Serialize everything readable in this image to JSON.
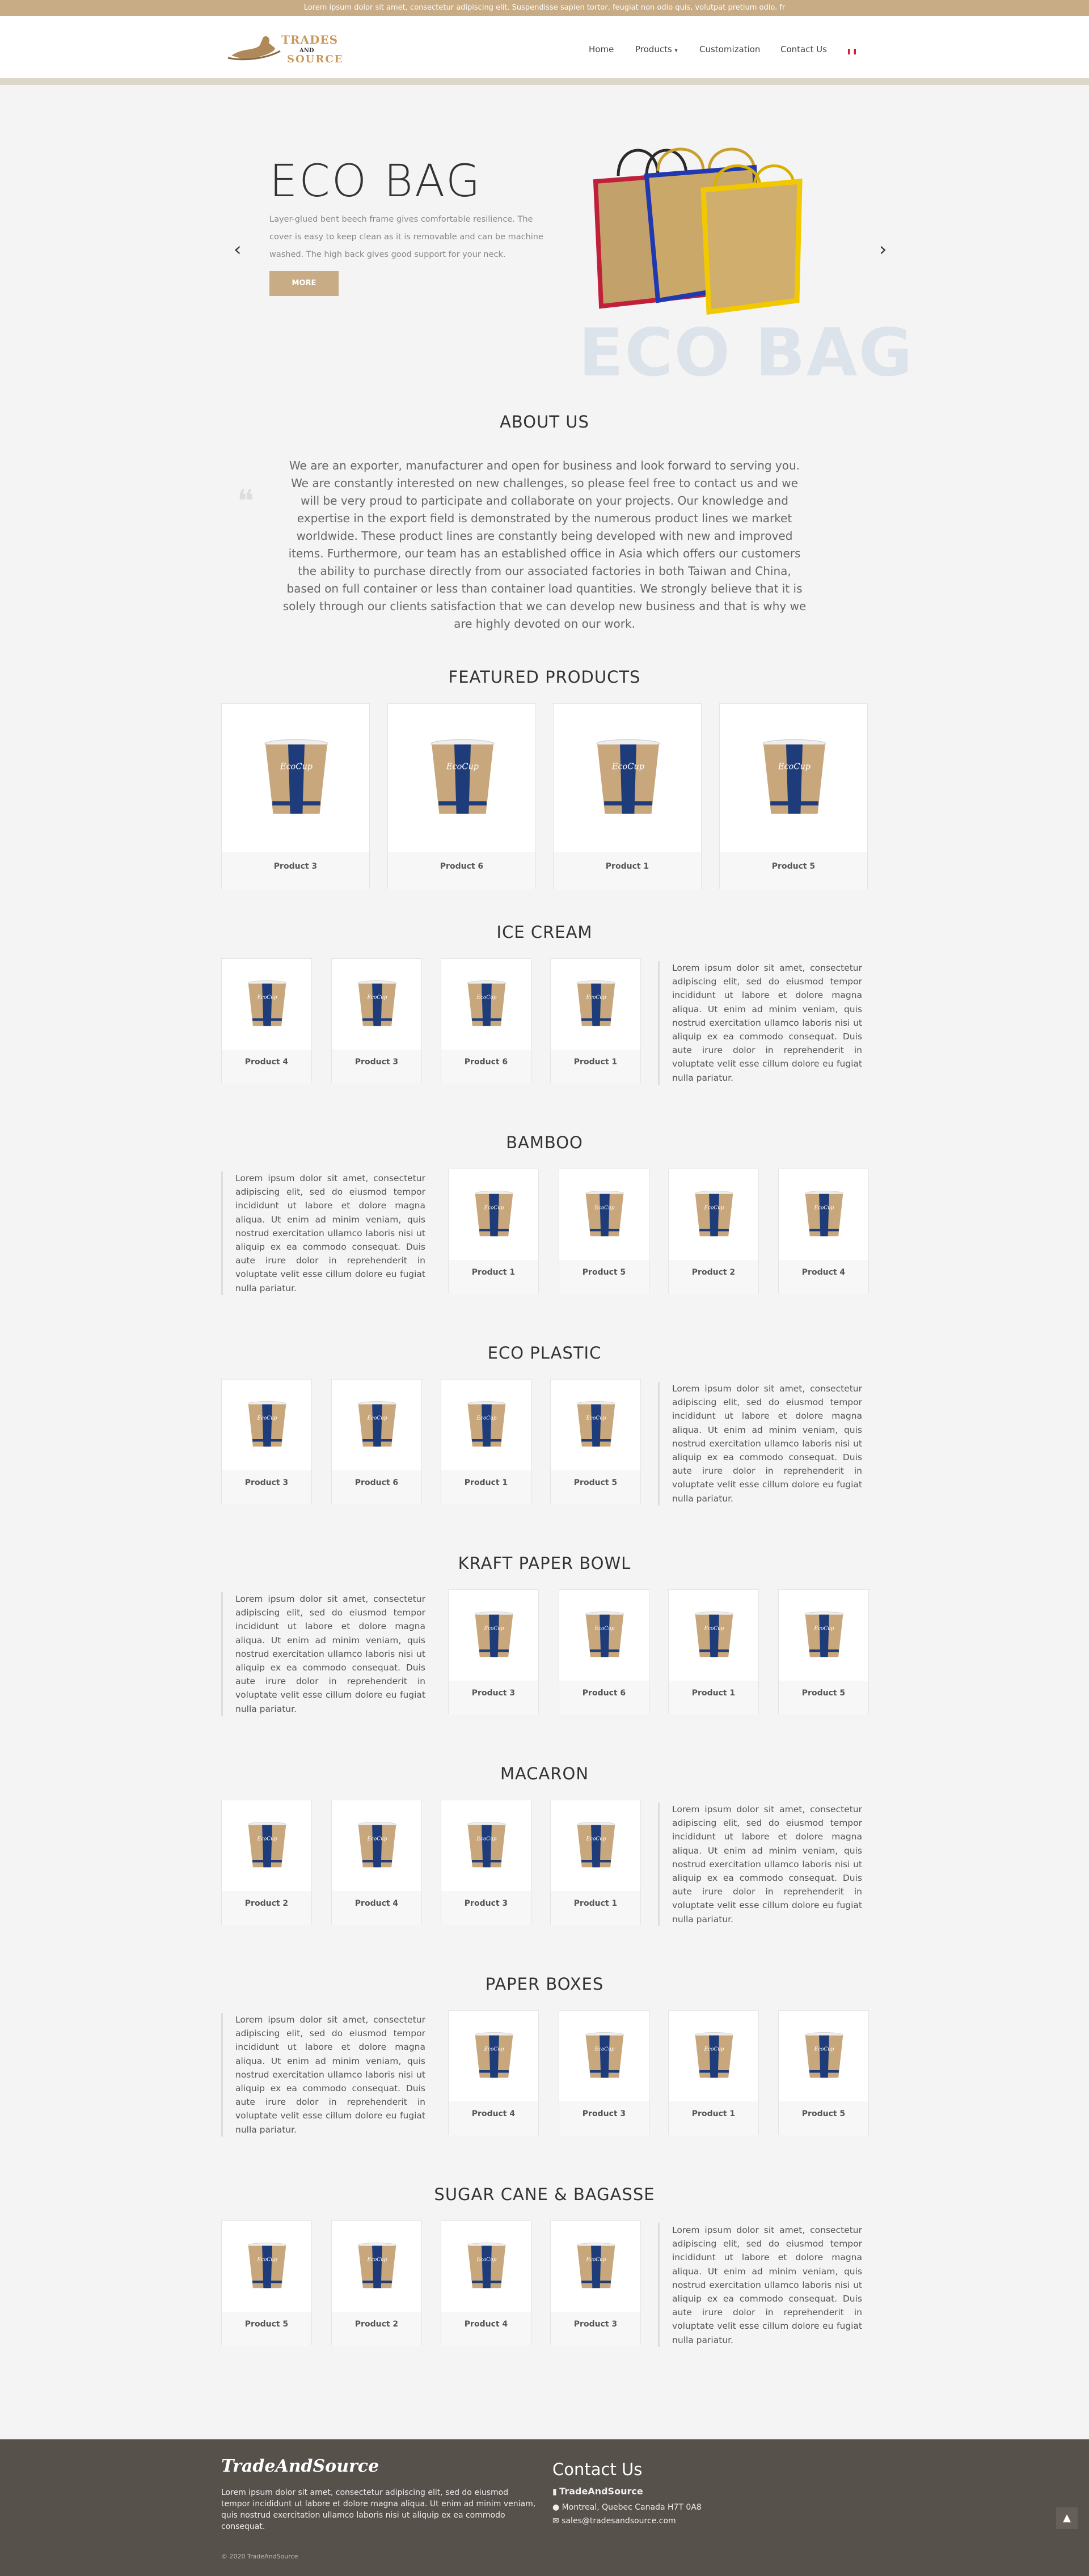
{
  "topbar": {
    "text": "Lorem ipsum dolor sit amet, consectetur adipiscing elit. Suspendisse sapien tortor, feugiat non odio quis, volutpat pretium odio. fr"
  },
  "logo": {
    "line1": "TRADES",
    "line2": "AND",
    "line3": "SOURCE"
  },
  "nav": {
    "home": "Home",
    "products": "Products",
    "customization": "Customization",
    "contact": "Contact Us"
  },
  "hero": {
    "title": "ECO BAG",
    "description": "Layer-glued bent beech frame gives comfortable resilience. The cover is easy to keep clean as it is removable and can be machine washed. The high back gives good support for your neck.",
    "button": "MORE",
    "watermark": "ECO BAG",
    "prev": "‹",
    "next": "›"
  },
  "about": {
    "title": "ABOUT US",
    "text": "We are an exporter, manufacturer and open for business and look forward to serving you. We are constantly interested on new challenges, so please feel free to contact us and we will be very proud to participate and collaborate on your projects. Our knowledge and expertise in the export field is demonstrated by the numerous product lines we market worldwide. These product lines are constantly being developed with new and improved items. Furthermore, our team has an established office in Asia which offers our customers the ability to purchase directly from our associated factories in both Taiwan and China, based on full container or less than container load quantities. We strongly believe that it is solely through our clients satisfaction that we can develop new business and that is why we are highly devoted on our work."
  },
  "featured": {
    "title": "FEATURED PRODUCTS",
    "products": [
      "Product 3",
      "Product 6",
      "Product 1",
      "Product 5"
    ]
  },
  "lorem": "Lorem ipsum dolor sit amet, consectetur adipiscing elit, sed do eiusmod tempor incididunt ut labore et dolore magna aliqua. Ut enim ad minim veniam, quis nostrud exercitation ullamco laboris nisi ut aliquip ex ea commodo consequat. Duis aute irure dolor in reprehenderit in voluptate velit esse cillum dolore eu fugiat nulla pariatur.",
  "categories": [
    {
      "title": "ICE CREAM",
      "products": [
        "Product 4",
        "Product 3",
        "Product 6",
        "Product 1"
      ]
    },
    {
      "title": "BAMBOO",
      "products": [
        "Product 1",
        "Product 5",
        "Product 2",
        "Product 4"
      ]
    },
    {
      "title": "ECO PLASTIC",
      "products": [
        "Product 3",
        "Product 6",
        "Product 1",
        "Product 5"
      ]
    },
    {
      "title": "KRAFT PAPER BOWL",
      "products": [
        "Product 3",
        "Product 6",
        "Product 1",
        "Product 5"
      ]
    },
    {
      "title": "MACARON",
      "products": [
        "Product 2",
        "Product 4",
        "Product 3",
        "Product 1"
      ]
    },
    {
      "title": "PAPER BOXES",
      "products": [
        "Product 4",
        "Product 3",
        "Product 1",
        "Product 5"
      ]
    },
    {
      "title": "SUGAR CANE & BAGASSE",
      "products": [
        "Product 5",
        "Product 2",
        "Product 4",
        "Product 3"
      ]
    }
  ],
  "footer": {
    "brand": "TradeAndSource",
    "description": "Lorem ipsum dolor sit amet, consectetur adipiscing elit, sed do eiusmod tempor incididunt ut labore et dolore magna aliqua. Ut enim ad minim veniam, quis nostrud exercitation ullamco laboris nisi ut aliquip ex ea commodo consequat.",
    "copyright": "© 2020 TradeAndSource",
    "contact_title": "Contact Us",
    "company": "TradeAndSource",
    "address": "Montreal, Quebec Canada H7T 0A8",
    "email": "sales@tradesandsource.com"
  },
  "colors": {
    "accent": "#c8ac85",
    "footer": "#57514c",
    "cup_blue": "#1f3c7a",
    "cup_kraft": "#c9a77c"
  }
}
